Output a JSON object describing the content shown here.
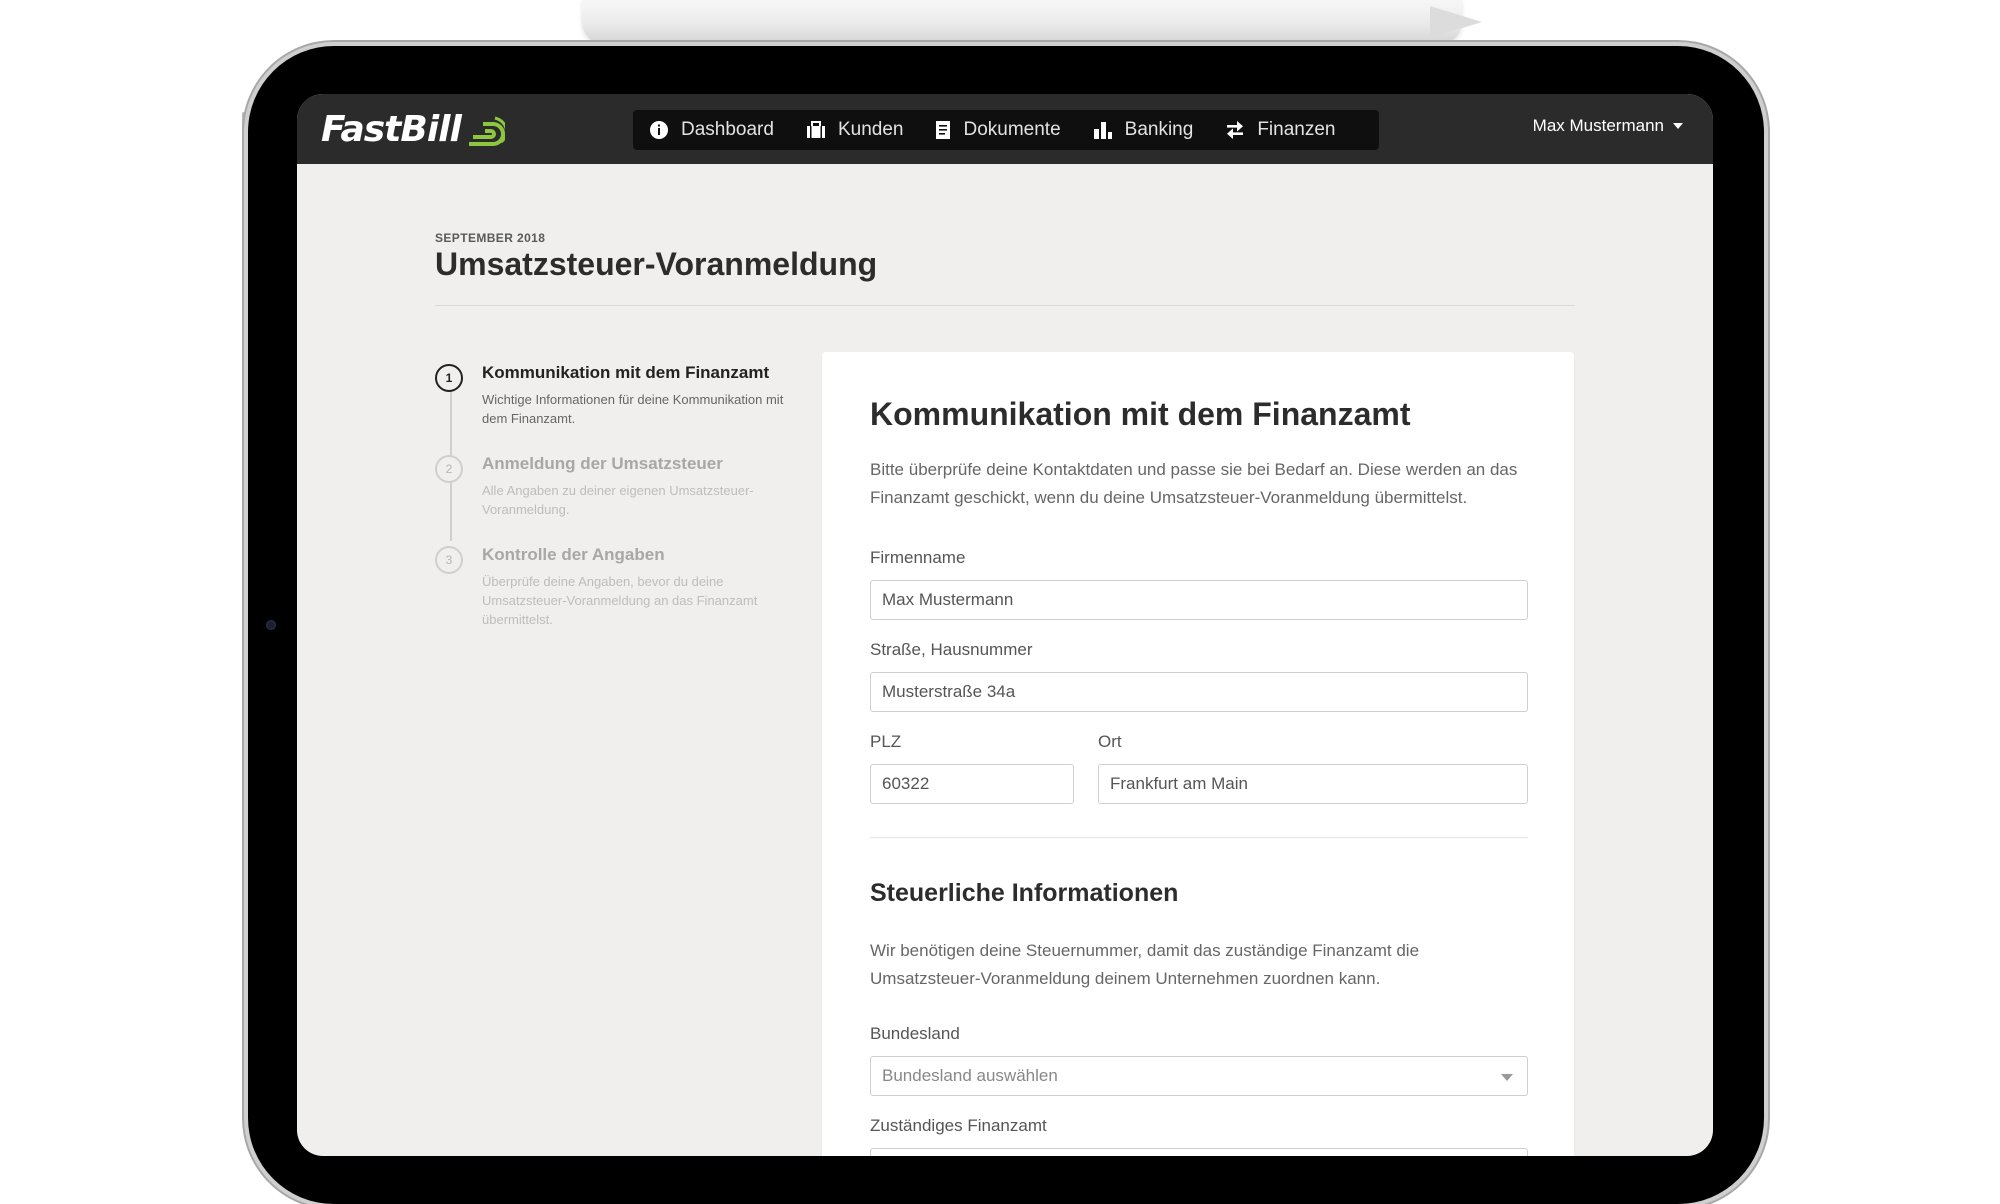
{
  "app": {
    "logo_text": "FastBill"
  },
  "nav": {
    "items": [
      {
        "label": "Dashboard",
        "icon": "info-circle-icon"
      },
      {
        "label": "Kunden",
        "icon": "briefcase-icon"
      },
      {
        "label": "Dokumente",
        "icon": "document-icon"
      },
      {
        "label": "Banking",
        "icon": "bar-chart-icon"
      },
      {
        "label": "Finanzen",
        "icon": "transfer-arrows-icon"
      }
    ],
    "user_name": "Max Mustermann"
  },
  "page": {
    "period": "SEPTEMBER 2018",
    "title": "Umsatzsteuer-Voranmeldung"
  },
  "steps": [
    {
      "number": "1",
      "title": "Kommunikation mit dem Finanzamt",
      "description": "Wichtige Informationen für deine Kommunikation mit dem Finanzamt.",
      "active": true
    },
    {
      "number": "2",
      "title": "Anmeldung der Umsatzsteuer",
      "description": "Alle Angaben zu deiner eigenen Umsatzsteuer-Voranmeldung.",
      "active": false
    },
    {
      "number": "3",
      "title": "Kontrolle der Angaben",
      "description": "Überprüfe deine Angaben, bevor du deine Umsatzsteuer-Voranmeldung an das Finanzamt übermittelst.",
      "active": false
    }
  ],
  "form": {
    "title": "Kommunikation mit dem Finanzamt",
    "intro": "Bitte überprüfe deine Kontaktdaten und passe sie bei Bedarf an. Diese werden an das Finanzamt geschickt, wenn du deine Umsatzsteuer-Voranmeldung übermittelst.",
    "company_label": "Firmenname",
    "company_value": "Max Mustermann",
    "street_label": "Straße, Hausnummer",
    "street_value": "Musterstraße 34a",
    "zip_label": "PLZ",
    "zip_value": "60322",
    "city_label": "Ort",
    "city_value": "Frankfurt am Main",
    "tax_title": "Steuerliche Informationen",
    "tax_intro": "Wir benötigen deine Steuernummer, damit das zuständige Finanzamt die Umsatzsteuer-Voranmeldung deinem Unternehmen zuordnen kann.",
    "state_label": "Bundesland",
    "state_placeholder": "Bundesland auswählen",
    "office_label": "Zuständiges Finanzamt"
  },
  "colors": {
    "topbar": "#2b2b2b",
    "nav_pill": "#0f0f0f",
    "logo_accent": "#8dc63f",
    "page_bg": "#f0efed"
  }
}
